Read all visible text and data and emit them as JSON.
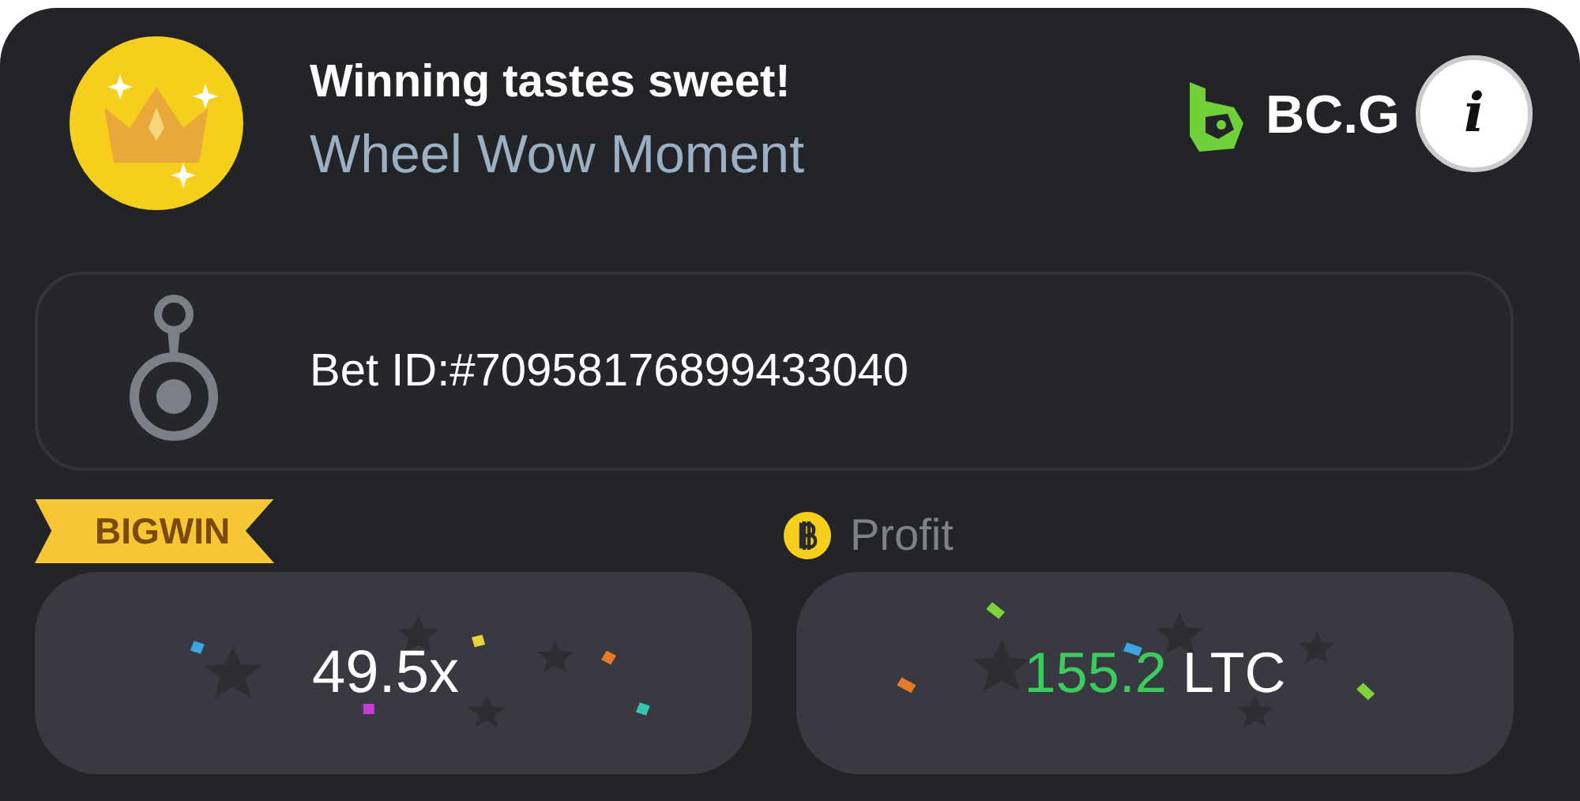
{
  "header": {
    "title": "Winning tastes sweet!",
    "subtitle": "Wheel Wow Moment",
    "logo_text": "BC.G",
    "info_button": "i"
  },
  "bet": {
    "label": "Bet ID:#70958176899433040"
  },
  "badge": "BIGWIN",
  "multiplier": "49.5x",
  "profit": {
    "label": "Profit",
    "amount": "155.2",
    "currency": "LTC"
  }
}
